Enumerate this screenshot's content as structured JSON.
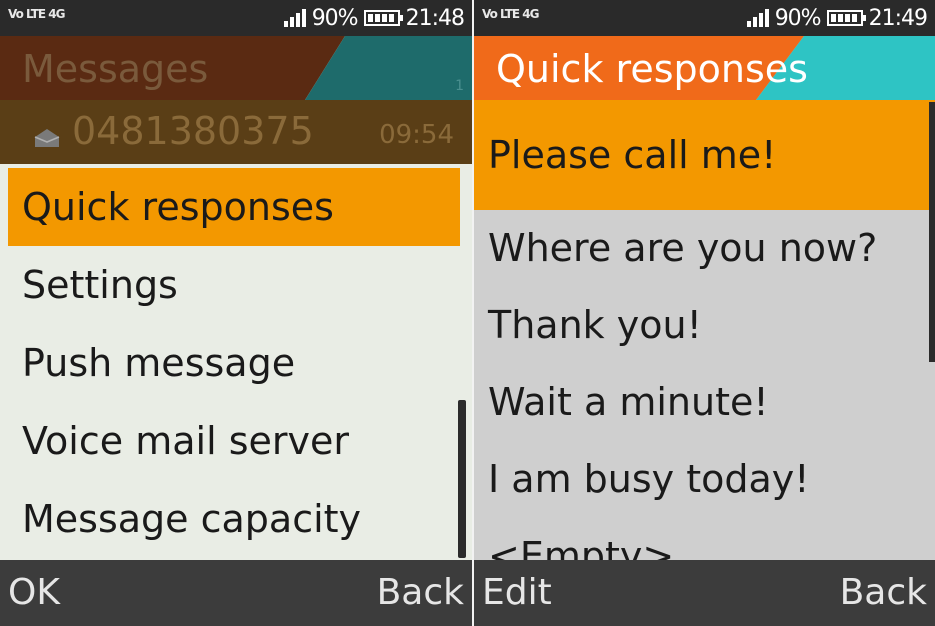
{
  "left": {
    "status": {
      "network": "Vo LTE 4G",
      "battery": "90%",
      "time": "21:48"
    },
    "header": {
      "title": "Messages",
      "indicator": "1"
    },
    "message_row": {
      "number": "0481380375",
      "time": "09:54"
    },
    "menu": {
      "items": [
        {
          "label": "Quick responses"
        },
        {
          "label": "Settings"
        },
        {
          "label": "Push message"
        },
        {
          "label": "Voice mail server"
        },
        {
          "label": "Message capacity"
        }
      ]
    },
    "softkeys": {
      "left": "OK",
      "right": "Back"
    }
  },
  "right": {
    "status": {
      "network": "Vo LTE 4G",
      "battery": "90%",
      "time": "21:49"
    },
    "header": {
      "title": "Quick responses"
    },
    "list": {
      "items": [
        {
          "label": "Please call me!"
        },
        {
          "label": "Where are you now?"
        },
        {
          "label": "Thank you!"
        },
        {
          "label": "Wait a minute!"
        },
        {
          "label": "I am busy today!"
        },
        {
          "label": "<Empty>"
        }
      ]
    },
    "softkeys": {
      "left": "Edit",
      "right": "Back"
    }
  },
  "colors": {
    "highlight": "#f39800",
    "header_left_bg": "#5a2a12",
    "header_left_accent": "#1e6b6b",
    "header_right_bg": "#f06a1a",
    "header_right_accent": "#2ec4c4",
    "softkey_bar": "#3c3c3c"
  },
  "icons": [
    "signal-icon",
    "battery-icon",
    "envelope-icon"
  ]
}
